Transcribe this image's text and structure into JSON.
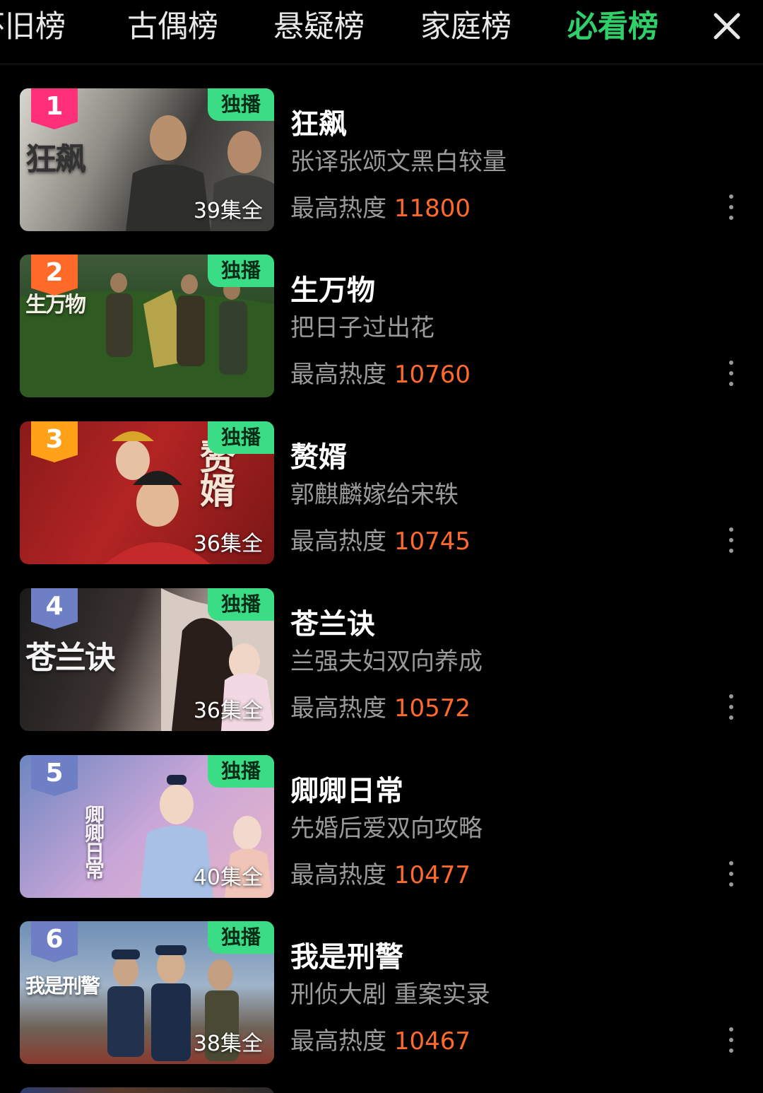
{
  "tabs": [
    {
      "label": "怀旧榜",
      "active": false
    },
    {
      "label": "古偶榜",
      "active": false
    },
    {
      "label": "悬疑榜",
      "active": false
    },
    {
      "label": "家庭榜",
      "active": false
    },
    {
      "label": "必看榜",
      "active": true
    }
  ],
  "close_icon": "close-icon",
  "colors": {
    "active_tab": "#2fd06a",
    "heat_value": "#ff6a2b",
    "exclusive_badge": "#3bdc86"
  },
  "heat_label": "最高热度",
  "items": [
    {
      "rank": "1",
      "badge": "独播",
      "title": "狂飙",
      "desc": "张译张颂文黑白较量",
      "heat": "11800",
      "episodes": "39集全",
      "poster_text": "狂飙",
      "rank_color": "#ff2f7a"
    },
    {
      "rank": "2",
      "badge": "独播",
      "title": "生万物",
      "desc": "把日子过出花",
      "heat": "10760",
      "episodes": "",
      "poster_text": "生万物",
      "rank_color": "#ff6a2b"
    },
    {
      "rank": "3",
      "badge": "独播",
      "title": "赘婿",
      "desc": "郭麒麟嫁给宋轶",
      "heat": "10745",
      "episodes": "36集全",
      "poster_text": "赘婿",
      "rank_color": "#ffa21a"
    },
    {
      "rank": "4",
      "badge": "独播",
      "title": "苍兰诀",
      "desc": "兰强夫妇双向养成",
      "heat": "10572",
      "episodes": "36集全",
      "poster_text": "苍兰诀",
      "rank_color": "#6f7fc6"
    },
    {
      "rank": "5",
      "badge": "独播",
      "title": "卿卿日常",
      "desc": "先婚后爱双向攻略",
      "heat": "10477",
      "episodes": "40集全",
      "poster_text": "卿卿日常",
      "rank_color": "#6f7fc6"
    },
    {
      "rank": "6",
      "badge": "独播",
      "title": "我是刑警",
      "desc": "刑侦大剧 重案实录",
      "heat": "10467",
      "episodes": "38集全",
      "poster_text": "我是刑警",
      "rank_color": "#6f7fc6"
    }
  ]
}
